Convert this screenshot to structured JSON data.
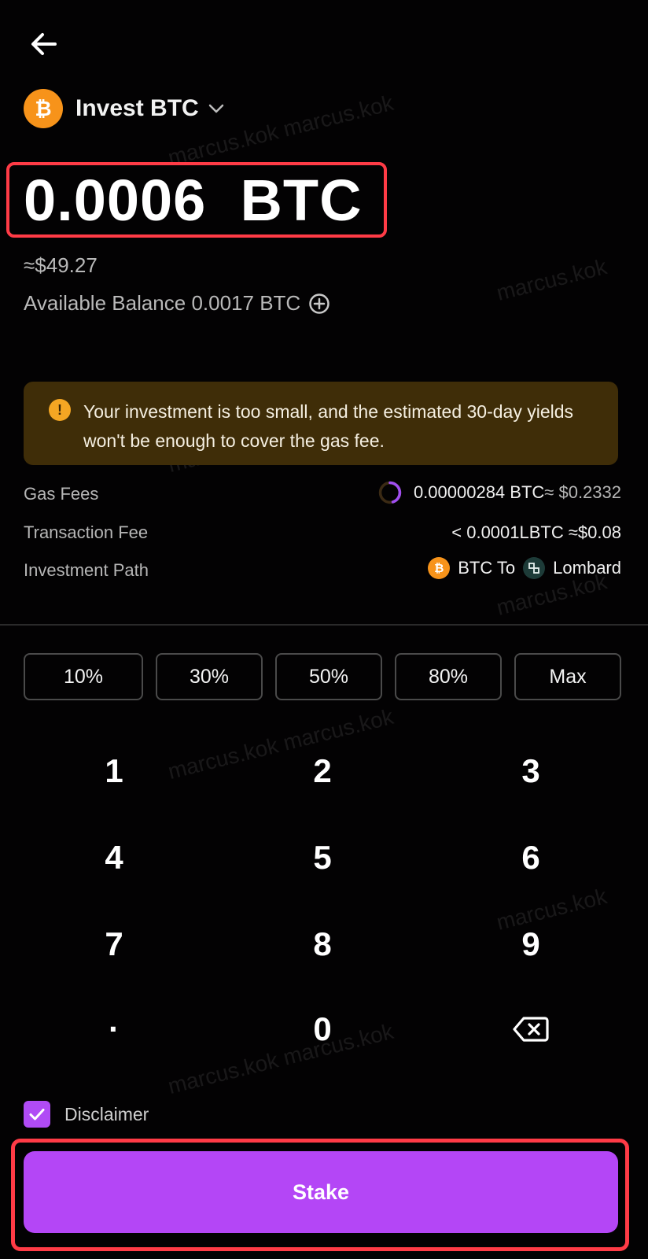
{
  "header": {
    "back_icon": "arrow-left-icon",
    "asset_symbol_glyph": "₿",
    "asset_title": "Invest BTC"
  },
  "amount": {
    "value": "0.0006  BTC",
    "fiat": "≈$49.27",
    "available_balance": "Available Balance 0.0017 BTC"
  },
  "warning": {
    "icon_glyph": "!",
    "text": "Your investment is too small, and the estimated 30-day yields won't be enough to cover the gas fee."
  },
  "fees": {
    "gas_label": "Gas Fees",
    "gas_value": "0.00000284 BTC",
    "gas_fiat": "≈ $0.2332",
    "transaction_label": "Transaction Fee",
    "transaction_value": "< 0.0001LBTC ≈$0.08",
    "path_label": "Investment Path",
    "path_from": "BTC To",
    "path_to": "Lombard"
  },
  "percent_buttons": [
    "10%",
    "30%",
    "50%",
    "80%",
    "Max"
  ],
  "keypad": {
    "keys": [
      "1",
      "2",
      "3",
      "4",
      "5",
      "6",
      "7",
      "8",
      "9",
      "·",
      "0"
    ],
    "backspace_icon": "backspace-icon"
  },
  "disclaimer": {
    "label": "Disclaimer",
    "checked": true
  },
  "stake_label": "Stake",
  "watermark": "marcus.kok",
  "colors": {
    "background": "#030203",
    "accent": "#b446f6",
    "btc": "#f7931a",
    "warning_bg": "#3f2d08",
    "highlight_outline": "#ff3b46"
  }
}
